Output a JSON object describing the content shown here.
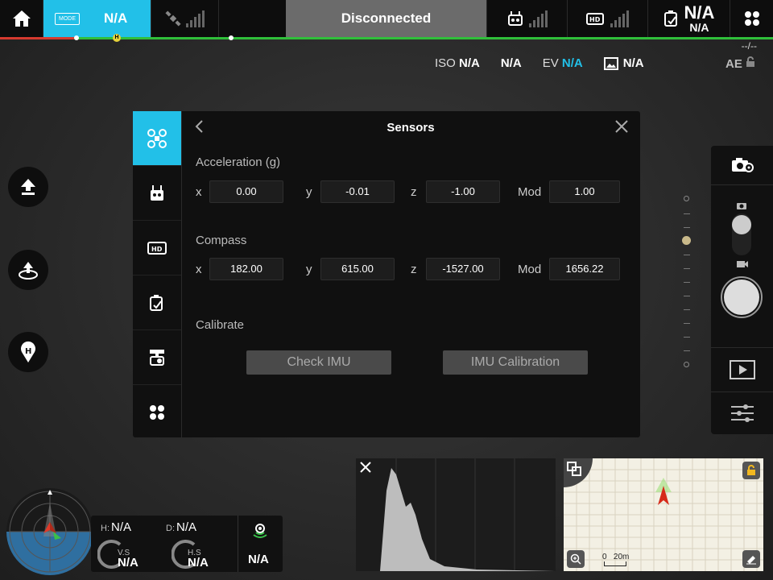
{
  "topbar": {
    "mode_badge": "MODE",
    "mode_value": "N/A",
    "connection": "Disconnected",
    "battery_big": "N/A",
    "battery_small": "N/A",
    "time_right": "--/--"
  },
  "camera": {
    "iso_label": "ISO",
    "iso_value": "N/A",
    "shutter_value": "N/A",
    "ev_label": "EV",
    "ev_value": "N/A",
    "format_value": "N/A",
    "ae_label": "AE"
  },
  "panel": {
    "title": "Sensors",
    "acceleration": {
      "label": "Acceleration (g)",
      "x_label": "x",
      "x": "0.00",
      "y_label": "y",
      "y": "-0.01",
      "z_label": "z",
      "z": "-1.00",
      "mod_label": "Mod",
      "mod": "1.00"
    },
    "compass": {
      "label": "Compass",
      "x_label": "x",
      "x": "182.00",
      "y_label": "y",
      "y": "615.00",
      "z_label": "z",
      "z": "-1527.00",
      "mod_label": "Mod",
      "mod": "1656.22"
    },
    "calibrate": {
      "label": "Calibrate",
      "check_imu": "Check IMU",
      "imu_calibration": "IMU Calibration"
    }
  },
  "telemetry": {
    "h_label": "H:",
    "h_value": "N/A",
    "d_label": "D:",
    "d_value": "N/A",
    "vs_label": "V.S",
    "vs_value": "N/A",
    "hs_label": "H.S",
    "hs_value": "N/A",
    "signal_value": "N/A"
  },
  "map": {
    "scale_zero": "0",
    "scale_value": "20m"
  },
  "colors": {
    "accent": "#22c0e8",
    "status_green": "#2fbf3a",
    "status_red": "#d63a2f"
  }
}
